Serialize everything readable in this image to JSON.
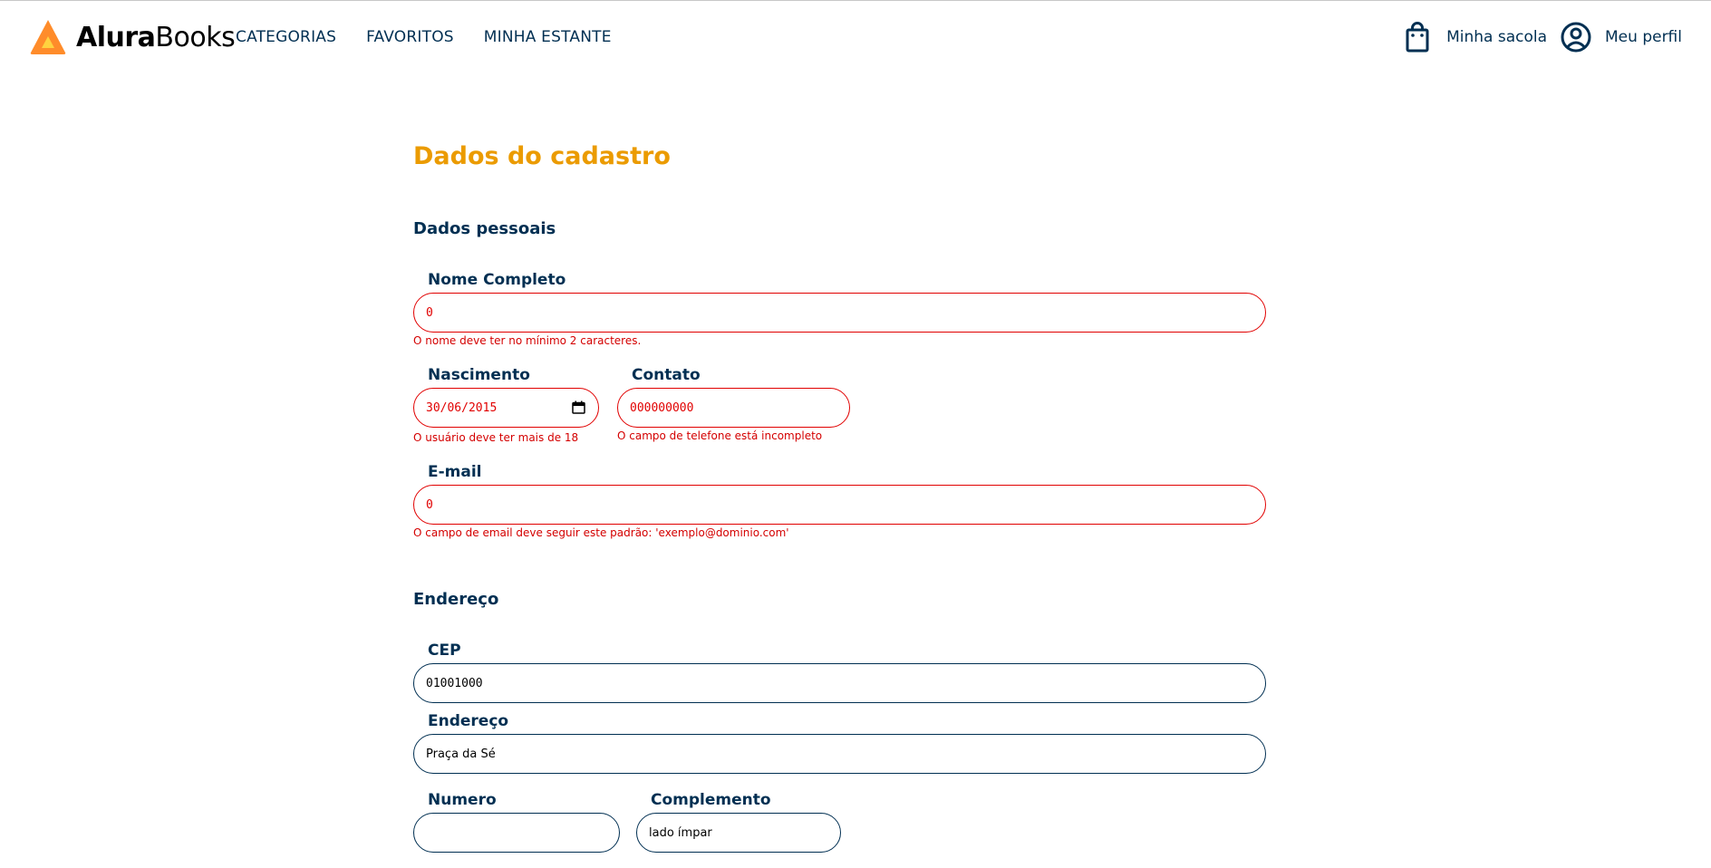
{
  "header": {
    "logo": {
      "strong": "Alura",
      "light": "Books"
    },
    "nav": [
      "CATEGORIAS",
      "FAVORITOS",
      "MINHA ESTANTE"
    ],
    "bag_label": "Minha sacola",
    "profile_label": "Meu perfil"
  },
  "form": {
    "title": "Dados do cadastro",
    "personal": {
      "title": "Dados pessoais",
      "name": {
        "label": "Nome Completo",
        "value": "0",
        "error": "O nome deve ter no mínimo 2 caracteres."
      },
      "birth": {
        "label": "Nascimento",
        "value": "30/06/2015",
        "error": "O usuário deve ter mais de 18"
      },
      "contact": {
        "label": "Contato",
        "value": "000000000",
        "error": "O campo de telefone está incompleto"
      },
      "email": {
        "label": "E-mail",
        "value": "0",
        "error": "O campo de email deve seguir este padrão: 'exemplo@dominio.com'"
      }
    },
    "address": {
      "title": "Endereço",
      "cep": {
        "label": "CEP",
        "value": "01001000"
      },
      "street": {
        "label": "Endereço",
        "value": "Praça da Sé"
      },
      "number": {
        "label": "Numero",
        "value": ""
      },
      "complement": {
        "label": "Complemento",
        "value": "lado ímpar"
      }
    }
  },
  "colors": {
    "accent": "#eb9b00",
    "primary": "#002f52",
    "error": "#e10000",
    "logo_orange": "#ff8c2a",
    "logo_yellow": "#ffd23f"
  },
  "icons": [
    "logo-triangle-icon",
    "shopping-bag-icon",
    "user-circle-icon",
    "calendar-icon"
  ]
}
